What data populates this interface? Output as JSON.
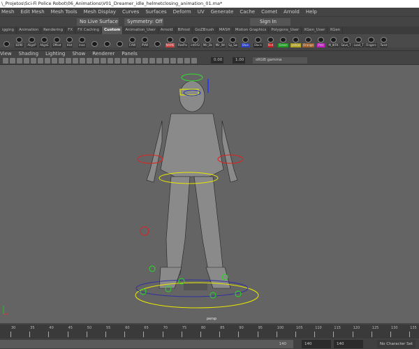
{
  "window": {
    "title": "\\_Projetos\\Sci-Fi Police Robot\\06_Animations\\V01_Dreamer_idle_helmetclosing_animation_01.ma*"
  },
  "menu": [
    "Mesh",
    "Edit Mesh",
    "Mesh Tools",
    "Mesh Display",
    "Curves",
    "Surfaces",
    "Deform",
    "UV",
    "Generate",
    "Cache",
    "Comet",
    "Arnold",
    "Help"
  ],
  "status": {
    "live_surface": "No Live Surface",
    "symmetry": "Symmetry: Off",
    "sign_in": "Sign In"
  },
  "shelf_tabs": [
    "igging",
    "Animation",
    "Rendering",
    "FX",
    "FX Caching",
    "Custom",
    "Animation_User",
    "Arnold",
    "Bifrost",
    "GoZBrush",
    "MASH",
    "Motion Graphics",
    "Polygons_User",
    "XGen_User",
    "XGen"
  ],
  "active_tab": "Custom",
  "shelf": [
    {
      "label": "",
      "color": "#333"
    },
    {
      "label": "8290",
      "color": "#333"
    },
    {
      "label": "AlignP",
      "color": "#333"
    },
    {
      "label": "AlignE",
      "color": "#333"
    },
    {
      "label": "Offset",
      "color": "#333"
    },
    {
      "label": "Hist",
      "color": "#333"
    },
    {
      "label": "Inve",
      "color": "#333"
    },
    {
      "label": "",
      "color": "#333"
    },
    {
      "label": "",
      "color": "#333"
    },
    {
      "label": "",
      "color": "#333"
    },
    {
      "label": "CVW",
      "color": "#333"
    },
    {
      "label": "PVW",
      "color": "#333"
    },
    {
      "label": "",
      "color": "#333"
    },
    {
      "label": "NAME",
      "color": "#c84040"
    },
    {
      "label": "ResPiv",
      "color": "#333"
    },
    {
      "label": "intFrSl",
      "color": "#333"
    },
    {
      "label": "Mir_Bs",
      "color": "#333"
    },
    {
      "label": "Mir_Wr",
      "color": "#333"
    },
    {
      "label": "Sp_Sw",
      "color": "#333"
    },
    {
      "label": "Blue",
      "color": "#2a3fc0"
    },
    {
      "label": "Black",
      "color": "#222"
    },
    {
      "label": "Red",
      "color": "#c02020"
    },
    {
      "label": "Green",
      "color": "#1f9a1f"
    },
    {
      "label": "yellow",
      "color": "#b0a020"
    },
    {
      "label": "Orange",
      "color": "#a0602a"
    },
    {
      "label": "Pink",
      "color": "#c020c0"
    },
    {
      "label": "M_IKFK",
      "color": "#333"
    },
    {
      "label": "Save_T",
      "color": "#333"
    },
    {
      "label": "Load_T",
      "color": "#333"
    },
    {
      "label": "Fingers",
      "color": "#333"
    },
    {
      "label": "Twist",
      "color": "#333"
    }
  ],
  "panel_menu": [
    "View",
    "Shading",
    "Lighting",
    "Show",
    "Renderer",
    "Panels"
  ],
  "panel_toolbar": {
    "exposure": "0.00",
    "gamma": "1.00",
    "color_space": "sRGB gamma"
  },
  "viewport": {
    "camera": "persp"
  },
  "timeline": {
    "ticks": [
      30,
      35,
      40,
      45,
      50,
      55,
      60,
      65,
      70,
      75,
      80,
      85,
      90,
      95,
      100,
      105,
      110,
      115,
      120,
      125,
      130,
      135
    ]
  },
  "range": {
    "range_end": "140",
    "anim_end": "140",
    "playback_end": "140",
    "character_set": "No Character Set"
  }
}
